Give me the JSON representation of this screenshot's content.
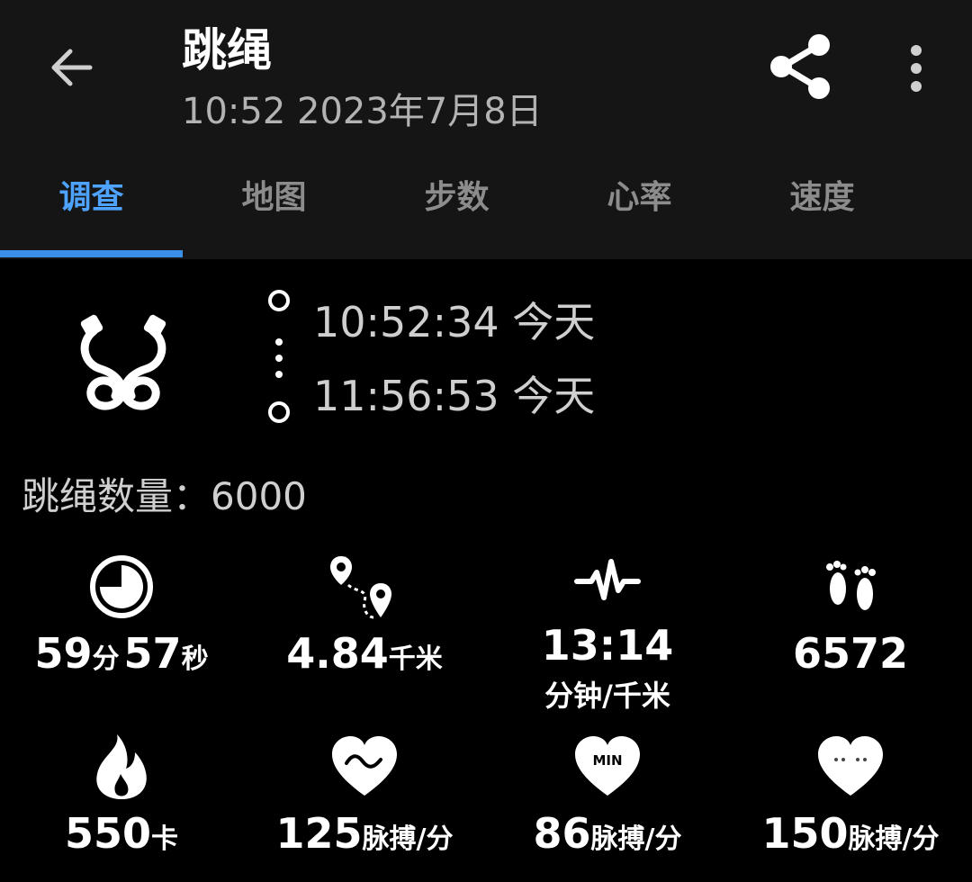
{
  "header": {
    "title": "跳绳",
    "subtitle": "10:52 2023年7月8日"
  },
  "tabs": [
    {
      "label": "调查",
      "active": true
    },
    {
      "label": "地图",
      "active": false
    },
    {
      "label": "步数",
      "active": false
    },
    {
      "label": "心率",
      "active": false
    },
    {
      "label": "速度",
      "active": false
    }
  ],
  "session": {
    "start_time": "10:52:34 今天",
    "end_time": "11:56:53 今天"
  },
  "jump_count": {
    "label": "跳绳数量：",
    "value": "6000"
  },
  "stats": {
    "duration": {
      "icon": "clock-icon",
      "min_value": "59",
      "min_unit": "分",
      "sec_value": "57",
      "sec_unit": "秒"
    },
    "distance": {
      "icon": "route-icon",
      "value": "4.84",
      "unit": "千米"
    },
    "pace": {
      "icon": "pulse-wave-icon",
      "value": "13:14",
      "unit": "分钟/千米"
    },
    "steps": {
      "icon": "footprints-icon",
      "value": "6572"
    },
    "calories": {
      "icon": "flame-icon",
      "value": "550",
      "unit": "卡"
    },
    "avg_heart_rate": {
      "icon": "heart-wave-icon",
      "value": "125",
      "unit": "脉搏/分"
    },
    "min_heart_rate": {
      "icon": "heart-min-icon",
      "badge": "MIN",
      "value": "86",
      "unit": "脉搏/分"
    },
    "max_heart_rate": {
      "icon": "heart-max-icon",
      "value": "150",
      "unit": "脉搏/分"
    }
  },
  "colors": {
    "accent": "#3b8fe6",
    "appbar_bg": "#151515",
    "background": "#000000"
  }
}
